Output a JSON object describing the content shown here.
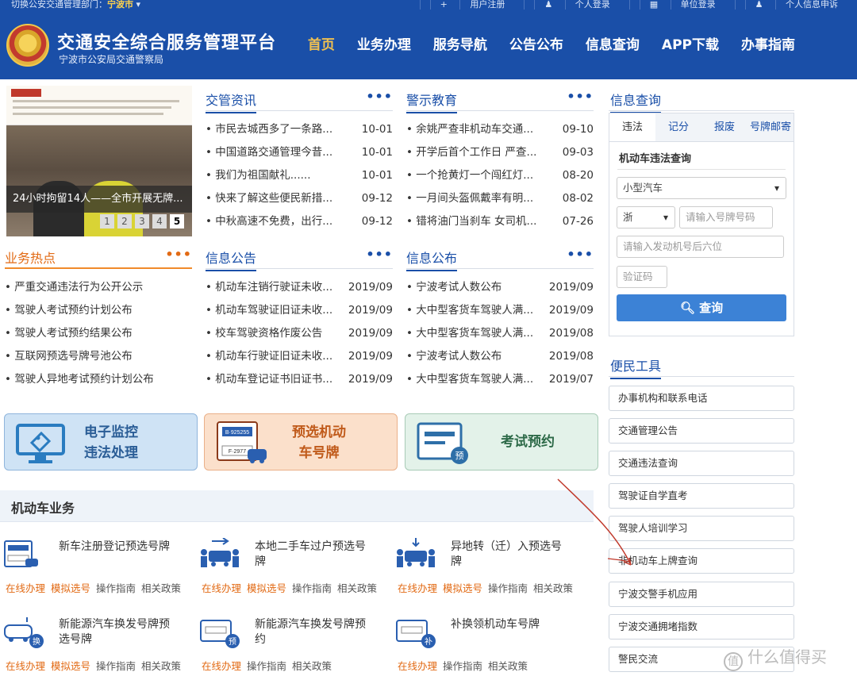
{
  "topbar": {
    "switch_label": "切换公安交通管理部门：",
    "city": "宁波市",
    "links": [
      "用户注册",
      "个人登录",
      "单位登录",
      "个人信息申诉"
    ]
  },
  "header": {
    "title": "交通安全综合服务管理平台",
    "subtitle": "宁波市公安局交通警察局",
    "nav": [
      "首页",
      "业务办理",
      "服务导航",
      "公告公布",
      "信息查询",
      "APP下载",
      "办事指南"
    ]
  },
  "carousel": {
    "caption": "24小时拘留14人——全市开展无牌...",
    "pages": [
      "1",
      "2",
      "3",
      "4",
      "5"
    ]
  },
  "more": "•••",
  "news": {
    "title": "交管资讯",
    "items": [
      {
        "text": "市民去城西多了一条路...",
        "date": "10-01"
      },
      {
        "text": "中国道路交通管理今昔...",
        "date": "10-01"
      },
      {
        "text": "我们为祖国献礼......",
        "date": "10-01"
      },
      {
        "text": "快来了解这些便民新措...",
        "date": "09-12"
      },
      {
        "text": "中秋高速不免费，出行...",
        "date": "09-12"
      }
    ]
  },
  "warning": {
    "title": "警示教育",
    "items": [
      {
        "text": "余姚严查非机动车交通...",
        "date": "09-10"
      },
      {
        "text": "开学后首个工作日 严查...",
        "date": "09-03"
      },
      {
        "text": "一个抢黄灯一个闯红灯...",
        "date": "08-20"
      },
      {
        "text": "一月间头盔佩戴率有明...",
        "date": "08-02"
      },
      {
        "text": "错将油门当刹车 女司机...",
        "date": "07-26"
      }
    ]
  },
  "hot": {
    "title": "业务热点",
    "items": [
      "严重交通违法行为公开公示",
      "驾驶人考试预约计划公布",
      "驾驶人考试预约结果公布",
      "互联网预选号牌号池公布",
      "驾驶人异地考试预约计划公布"
    ]
  },
  "notice": {
    "title": "信息公告",
    "items": [
      {
        "text": "机动车注销行驶证未收...",
        "date": "2019/09"
      },
      {
        "text": "机动车驾驶证旧证未收...",
        "date": "2019/09"
      },
      {
        "text": "校车驾驶资格作废公告",
        "date": "2019/09"
      },
      {
        "text": "机动车行驶证旧证未收...",
        "date": "2019/09"
      },
      {
        "text": "机动车登记证书旧证书...",
        "date": "2019/09"
      }
    ]
  },
  "publish": {
    "title": "信息公布",
    "items": [
      {
        "text": "宁波考试人数公布",
        "date": "2019/09"
      },
      {
        "text": "大中型客货车驾驶人满...",
        "date": "2019/09"
      },
      {
        "text": "大中型客货车驾驶人满...",
        "date": "2019/08"
      },
      {
        "text": "宁波考试人数公布",
        "date": "2019/08"
      },
      {
        "text": "大中型客货车驾驶人满...",
        "date": "2019/07"
      }
    ]
  },
  "cards": [
    {
      "label": "电子监控\n违法处理"
    },
    {
      "label": "预选机动\n车号牌"
    },
    {
      "label": "考试预约"
    }
  ],
  "card_icon_text": {
    "plate1": "B·925255",
    "plate2": "F·2977",
    "badge": "预"
  },
  "business": {
    "title": "机动车业务",
    "items": [
      {
        "title": "新车注册登记预选号牌",
        "links": [
          "在线办理",
          "模拟选号",
          "操作指南",
          "相关政策"
        ]
      },
      {
        "title": "本地二手车过户预选号牌",
        "links": [
          "在线办理",
          "模拟选号",
          "操作指南",
          "相关政策"
        ]
      },
      {
        "title": "异地转（迁）入预选号牌",
        "links": [
          "在线办理",
          "模拟选号",
          "操作指南",
          "相关政策"
        ]
      },
      {
        "title": "新能源汽车换发号牌预选号牌",
        "links": [
          "在线办理",
          "模拟选号",
          "操作指南",
          "相关政策"
        ]
      },
      {
        "title": "新能源汽车换发号牌预约",
        "links": [
          "在线办理",
          "操作指南",
          "相关政策"
        ]
      },
      {
        "title": "补换领机动车号牌",
        "links": [
          "在线办理",
          "操作指南",
          "相关政策"
        ]
      }
    ],
    "icon_badges": [
      "换",
      "预",
      "补"
    ]
  },
  "query": {
    "title": "信息查询",
    "tabs": [
      "违法",
      "记分",
      "报废",
      "号牌邮寄"
    ],
    "form_title": "机动车违法查询",
    "vehicle_type": "小型汽车",
    "province": "浙",
    "plate_placeholder": "请输入号牌号码",
    "engine_placeholder": "请输入发动机号后六位",
    "captcha_placeholder": "验证码",
    "submit": "查询"
  },
  "tools": {
    "title": "便民工具",
    "items": [
      "办事机构和联系电话",
      "交通管理公告",
      "交通违法查询",
      "驾驶证自学直考",
      "驾驶人培训学习",
      "非机动车上牌查询",
      "宁波交警手机应用",
      "宁波交通拥堵指数",
      "警民交流"
    ]
  },
  "watermark": "什么值得买",
  "colors": {
    "brand": "#1a4fa8",
    "accent_orange": "#e26a14",
    "nav_active": "#f0c050",
    "button": "#3c82d6",
    "arrow": "#c0392b"
  }
}
